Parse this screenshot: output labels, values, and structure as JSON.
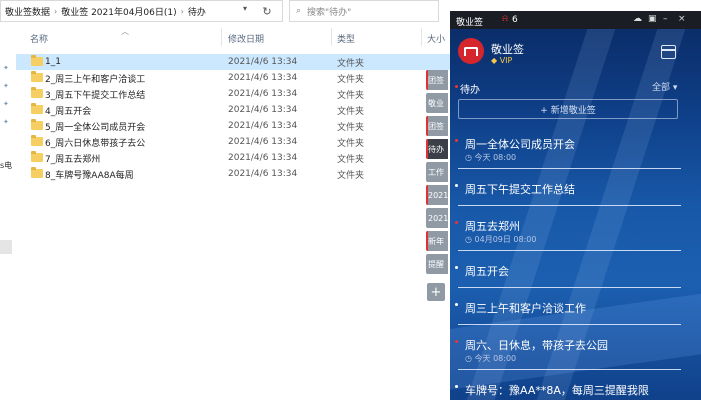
{
  "explorer": {
    "breadcrumb": [
      "敬业签数据",
      "敬业签 2021年04月06日(1)",
      "待办"
    ],
    "search_placeholder": "搜索\"待办\"",
    "nav_partial_label": "s电",
    "columns": {
      "name": "名称",
      "date": "修改日期",
      "type": "类型",
      "size": "大小"
    },
    "files": [
      {
        "name": "1_1",
        "date": "2021/4/6 13:34",
        "type": "文件夹",
        "selected": true
      },
      {
        "name": "2_周三上午和客户洽谈工",
        "date": "2021/4/6 13:34",
        "type": "文件夹"
      },
      {
        "name": "3_周五下午提交工作总结",
        "date": "2021/4/6 13:34",
        "type": "文件夹"
      },
      {
        "name": "4_周五开会",
        "date": "2021/4/6 13:34",
        "type": "文件夹"
      },
      {
        "name": "5_周一全体公司成员开会",
        "date": "2021/4/6 13:34",
        "type": "文件夹"
      },
      {
        "name": "6_周六日休息带孩子去公",
        "date": "2021/4/6 13:34",
        "type": "文件夹"
      },
      {
        "name": "7_周五去郑州",
        "date": "2021/4/6 13:34",
        "type": "文件夹"
      },
      {
        "name": "8_车牌号豫AA8A每周",
        "date": "2021/4/6 13:34",
        "type": "文件夹"
      }
    ]
  },
  "side_tabs": [
    "团签",
    "敬业",
    "团签",
    "待办",
    "工作",
    "2021",
    "2021",
    "新年",
    "提醒"
  ],
  "side_tab_add": "+",
  "app": {
    "title": "敬业签",
    "notify_count": "6",
    "user_name": "敬业签",
    "vip_label": "VIP",
    "section": "待办",
    "filter": "全部",
    "new_button": "+ 新增敬业签",
    "tasks": [
      {
        "title": "周一全体公司成员开会",
        "time": "今天 08:00",
        "marker": "red"
      },
      {
        "title": "周五下午提交工作总结",
        "time": "",
        "marker": "white"
      },
      {
        "title": "周五去郑州",
        "time": "04月09日 08:00",
        "marker": "red"
      },
      {
        "title": "周五开会",
        "time": "",
        "marker": "white"
      },
      {
        "title": "周三上午和客户洽谈工作",
        "time": "",
        "marker": "white"
      },
      {
        "title": "周六、日休息，带孩子去公园",
        "time": "今天 08:00",
        "marker": "red"
      },
      {
        "title": "车牌号：豫AA**8A，每周三提醒我限",
        "time": "",
        "marker": "white"
      }
    ]
  },
  "colors": {
    "accent_red": "#d6262d",
    "selection": "#cce8ff",
    "folder": "#f6cf64",
    "panel_blue": "#1858a8"
  }
}
